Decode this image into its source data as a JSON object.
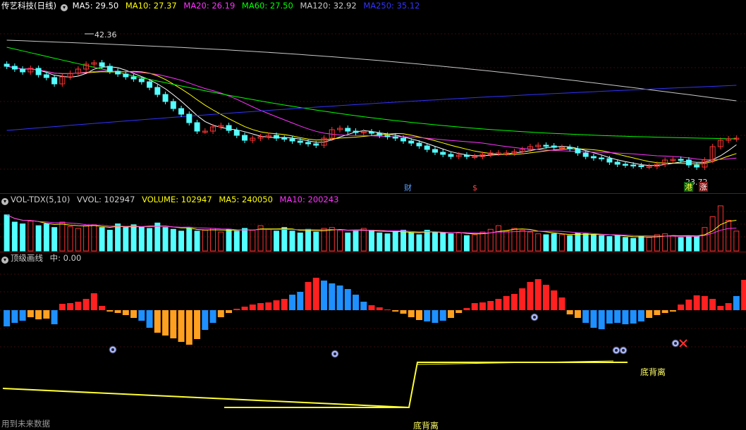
{
  "stock": {
    "title": "传艺科技(日线)",
    "ma_labels": [
      {
        "text": "MA5: 29.50",
        "color": "#ffffff"
      },
      {
        "text": "MA10: 27.37",
        "color": "#ffff00"
      },
      {
        "text": "MA20: 26.19",
        "color": "#ff33ff"
      },
      {
        "text": "MA60: 27.50",
        "color": "#00ff00"
      },
      {
        "text": "MA120: 32.92",
        "color": "#c8c8c8"
      },
      {
        "text": "MA250: 35.12",
        "color": "#3333ff"
      }
    ],
    "price_high_label": "42.36",
    "price_low_label": "23.72"
  },
  "volume_panel": {
    "labels": [
      {
        "text": "VOL-TDX(5,10)",
        "color": "#cccccc"
      },
      {
        "text": "VVOL: 102947",
        "color": "#cccccc"
      },
      {
        "text": "VOLUME: 102947",
        "color": "#ffff00"
      },
      {
        "text": "MA5: 240050",
        "color": "#ffff00"
      },
      {
        "text": "MA10: 200243",
        "color": "#ff33ff"
      }
    ]
  },
  "indicator_panel": {
    "labels": [
      {
        "text": "顶级画线",
        "color": "#cccccc"
      },
      {
        "text": "中: 0.00",
        "color": "#cccccc"
      }
    ],
    "divergence_label_1": "底背离",
    "divergence_label_2": "底背离"
  },
  "event_markers": {
    "cai": "财",
    "dollar": "$",
    "gang": "港",
    "zhang": "涨"
  },
  "footer": "用到未来数据",
  "colors": {
    "up": "#ff3333",
    "down": "#54ffff",
    "ind_red": "#ff2020",
    "ind_blue": "#1e90ff",
    "ind_orange": "#ffa020",
    "line_yellow": "#ffff33"
  },
  "chart_data": [
    {
      "type": "candlestick",
      "title": "传艺科技(日线)",
      "ylim": [
        21,
        45
      ],
      "closes": [
        37.8,
        37.4,
        37.0,
        37.5,
        36.6,
        36.2,
        35.3,
        36.3,
        36.8,
        37.4,
        38.1,
        38.3,
        37.8,
        37.1,
        36.7,
        36.3,
        36.0,
        35.6,
        34.8,
        33.8,
        32.8,
        31.8,
        31.0,
        29.8,
        28.6,
        28.6,
        29.2,
        29.4,
        28.7,
        28.0,
        27.3,
        27.6,
        27.8,
        28.0,
        27.6,
        27.5,
        27.2,
        27.0,
        26.8,
        26.6,
        27.6,
        28.8,
        29.0,
        28.6,
        28.4,
        28.5,
        28.3,
        28.0,
        27.8,
        27.6,
        27.2,
        26.9,
        26.5,
        26.0,
        25.6,
        25.3,
        25.0,
        25.2,
        25.0,
        25.0,
        25.3,
        25.5,
        25.5,
        25.5,
        25.7,
        26.0,
        26.4,
        26.6,
        26.5,
        26.3,
        26.3,
        26.1,
        25.5,
        25.0,
        24.8,
        24.7,
        24.2,
        23.9,
        23.8,
        23.7,
        23.6,
        23.6,
        23.9,
        24.5,
        24.6,
        24.5,
        23.8,
        23.5,
        24.5,
        26.4,
        27.3,
        27.5,
        27.6
      ],
      "high": 42.36,
      "low": 23.72,
      "moving_averages": [
        {
          "name": "MA5",
          "value": 29.5
        },
        {
          "name": "MA10",
          "value": 27.37
        },
        {
          "name": "MA20",
          "value": 26.19
        },
        {
          "name": "MA60",
          "value": 27.5
        },
        {
          "name": "MA120",
          "value": 32.92
        },
        {
          "name": "MA250",
          "value": 35.12
        }
      ]
    },
    {
      "type": "bar",
      "title": "VOL-TDX(5,10)",
      "last": {
        "VVOL": 102947,
        "VOLUME": 102947,
        "MA5": 240050,
        "MA10": 200243
      },
      "values": [
        4,
        3.2,
        3.0,
        3.3,
        2.8,
        3.0,
        2.6,
        3.2,
        2.7,
        2.5,
        2.8,
        2.9,
        2.6,
        2.3,
        3.0,
        2.6,
        2.9,
        2.7,
        2.5,
        3.1,
        2.6,
        2.4,
        2.2,
        2.5,
        2.2,
        2.3,
        2.5,
        2.1,
        2.4,
        2.2,
        2.5,
        2.3,
        2.8,
        2.4,
        2.2,
        2.6,
        2.2,
        2.0,
        2.4,
        2.1,
        2.5,
        2.6,
        2.3,
        2.0,
        2.2,
        2.5,
        2.3,
        2.0,
        1.9,
        2.1,
        2.3,
        2.0,
        1.8,
        2.3,
        2.1,
        2.0,
        1.9,
        2.0,
        1.7,
        1.8,
        2.1,
        2.4,
        2.8,
        2.2,
        2.5,
        2.3,
        2.1,
        1.9,
        1.8,
        1.9,
        1.8,
        1.7,
        2.0,
        1.9,
        1.8,
        1.7,
        1.6,
        1.7,
        1.5,
        1.4,
        1.6,
        1.5,
        1.8,
        1.9,
        1.7,
        1.5,
        1.6,
        1.6,
        2.6,
        3.8,
        5.0,
        3.4,
        2.2
      ]
    },
    {
      "type": "bar",
      "title": "顶级画线",
      "values": [
        -2.3,
        -1.8,
        -1.5,
        -1.0,
        -1.3,
        -1.2,
        -2.0,
        0.9,
        1.0,
        1.2,
        1.6,
        2.4,
        0.6,
        -0.2,
        -0.4,
        -0.7,
        -1.1,
        -1.5,
        -2.5,
        -3.2,
        -3.6,
        -4.0,
        -4.5,
        -4.9,
        -4.1,
        -2.8,
        -1.8,
        -1.0,
        -0.4,
        0.2,
        0.5,
        0.8,
        1.0,
        1.1,
        1.4,
        1.6,
        2.2,
        2.6,
        4.0,
        4.6,
        4.2,
        3.8,
        3.5,
        3.0,
        2.2,
        1.2,
        0.7,
        0.4,
        0.1,
        -0.2,
        -0.5,
        -1.0,
        -1.4,
        -1.6,
        -1.8,
        -1.5,
        -1.1,
        -0.4,
        0.3,
        1.0,
        1.1,
        1.3,
        1.6,
        2.0,
        2.3,
        3.1,
        4.0,
        4.4,
        3.6,
        2.8,
        1.8,
        -0.6,
        -1.1,
        -1.8,
        -2.5,
        -2.7,
        -1.9,
        -1.8,
        -2.0,
        -1.9,
        -1.6,
        -1.1,
        -0.7,
        -0.4,
        -0.2,
        0.8,
        1.5,
        2.1,
        2.0,
        1.6,
        0.6,
        1.0,
        2.0,
        4.3,
        5.2,
        6.3,
        6.0
      ]
    }
  ]
}
